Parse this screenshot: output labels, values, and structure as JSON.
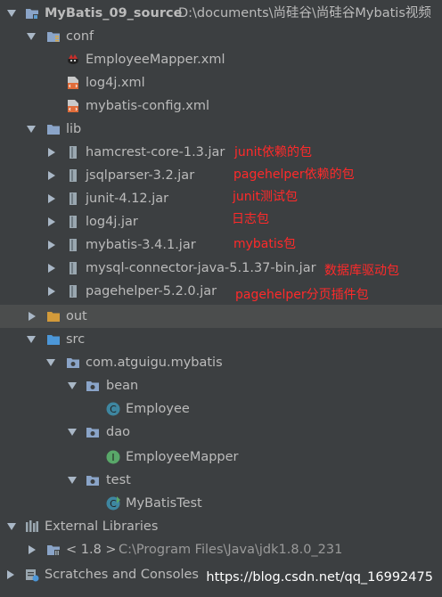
{
  "project": {
    "name": "MyBatis_09_source",
    "path": "D:\\documents\\尚硅谷\\尚硅谷Mybatis视频"
  },
  "conf": {
    "label": "conf",
    "files": [
      "EmployeeMapper.xml",
      "log4j.xml",
      "mybatis-config.xml"
    ]
  },
  "lib": {
    "label": "lib",
    "jars": [
      {
        "name": "hamcrest-core-1.3.jar",
        "note": "junit依赖的包"
      },
      {
        "name": "jsqlparser-3.2.jar",
        "note": "pagehelper依赖的包"
      },
      {
        "name": "junit-4.12.jar",
        "note": "junit测试包"
      },
      {
        "name": "log4j.jar",
        "note": "日志包"
      },
      {
        "name": "mybatis-3.4.1.jar",
        "note": "mybatis包"
      },
      {
        "name": "mysql-connector-java-5.1.37-bin.jar",
        "note": "数据库驱动包"
      },
      {
        "name": "pagehelper-5.2.0.jar",
        "note": "pagehelper分页插件包"
      }
    ]
  },
  "out": {
    "label": "out"
  },
  "src": {
    "label": "src",
    "package": "com.atguigu.mybatis",
    "bean": {
      "label": "bean",
      "class": "Employee"
    },
    "dao": {
      "label": "dao",
      "interface": "EmployeeMapper"
    },
    "test": {
      "label": "test",
      "class": "MyBatisTest"
    }
  },
  "external": {
    "label": "External Libraries",
    "jdk_label": "< 1.8 >",
    "jdk_path": "C:\\Program Files\\Java\\jdk1.8.0_231"
  },
  "scratches": {
    "label": "Scratches and Consoles"
  },
  "watermark": "https://blog.csdn.net/qq_16992475",
  "colors": {
    "background": "#3c3f41",
    "selection": "#4b4d4d",
    "text": "#bbbbbb",
    "annotation": "#ff2a2a",
    "folder": "#8aa4c8",
    "folder_src": "#4c97d8",
    "folder_out": "#d29a3a",
    "class_icon": "#3e86a0",
    "interface_icon": "#59a869"
  }
}
